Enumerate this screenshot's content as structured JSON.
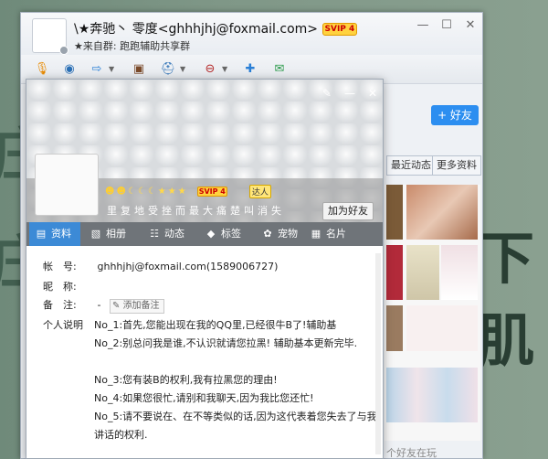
{
  "background": {
    "text_left_top": "庄刚",
    "text_left_bottom": "庄洋",
    "text_right": "下肌"
  },
  "window": {
    "title": "\\★奔驰丶 零度<ghhhjhj@foxmail.com>",
    "vip_badge": "SVIP 4",
    "from_group": "★来自群: 跑跑辅助共享群",
    "controls": [
      "—",
      "☐",
      "✕"
    ]
  },
  "toolbar": {
    "icons": [
      "microphone-icon",
      "video-icon",
      "file-transfer-icon",
      "remote-desktop-icon",
      "app-icon",
      "block-icon",
      "add-contact-icon",
      "create-group-icon"
    ]
  },
  "side": {
    "add_friend": "+ 好友",
    "tabs": [
      "最近动态",
      "更多资料"
    ],
    "footer": "个好友在玩"
  },
  "card": {
    "ctrl_icons": [
      "edit-icon",
      "minimize-icon",
      "close-icon"
    ],
    "signature": "里复地受挫而最大痛楚叫消失",
    "svip": "SVIP 4",
    "daren": "达人",
    "add_friend_btn": "加为好友",
    "tabs": [
      {
        "label": "资料",
        "icon": "profile-icon"
      },
      {
        "label": "相册",
        "icon": "album-icon"
      },
      {
        "label": "动态",
        "icon": "feed-icon"
      },
      {
        "label": "标签",
        "icon": "tag-icon"
      },
      {
        "label": "宠物",
        "icon": "pet-icon"
      },
      {
        "label": "名片",
        "icon": "card-icon"
      }
    ],
    "fields": {
      "account_label": "帐　号:",
      "account_value": "ghhhjhj@foxmail.com(1589006727)",
      "nickname_label": "昵　称:",
      "nickname_value": "",
      "remark_label": "备　注:",
      "remark_value": "-",
      "remark_btn": "添加备注",
      "intro_label": "个人说明"
    },
    "intro": [
      "No_1:首先,您能出现在我的QQ里,已经很牛B了!辅助基",
      "No_2:别总问我是谁,不认识就请您拉黑!  辅助基本更新完毕.",
      "No_3:您有装B的权利,我有拉黑您的理由!",
      "No_4:如果您很忙,请别和我聊天,因为我比您还忙!",
      "No_5:请不要说在、在不等类似的话,因为这代表着您失去了与我",
      "讲话的权利."
    ]
  }
}
